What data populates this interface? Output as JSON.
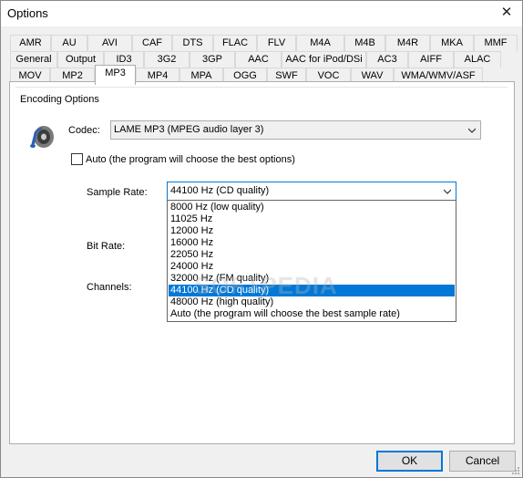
{
  "window": {
    "title": "Options"
  },
  "tabs": {
    "row1": [
      "AMR",
      "AU",
      "AVI",
      "CAF",
      "DTS",
      "FLAC",
      "FLV",
      "M4A",
      "M4B",
      "M4R",
      "MKA",
      "MMF"
    ],
    "row2": [
      "General",
      "Output",
      "ID3",
      "3G2",
      "3GP",
      "AAC",
      "AAC for iPod/DSi",
      "AC3",
      "AIFF",
      "ALAC"
    ],
    "row3": [
      "MOV",
      "MP2",
      "MP3",
      "MP4",
      "MPA",
      "OGG",
      "SWF",
      "VOC",
      "WAV",
      "WMA/WMV/ASF"
    ],
    "active": "MP3"
  },
  "encoding": {
    "group_label": "Encoding Options",
    "codec_label": "Codec:",
    "codec_value": "LAME MP3 (MPEG audio layer 3)",
    "auto_label": "Auto (the program will choose the best options)",
    "auto_checked": false,
    "sample_rate_label": "Sample Rate:",
    "sample_rate_value": "44100 Hz (CD quality)",
    "bit_rate_label": "Bit Rate:",
    "channels_label": "Channels:"
  },
  "sample_rate_options": [
    "8000 Hz (low quality)",
    "11025 Hz",
    "12000 Hz",
    "16000 Hz",
    "22050 Hz",
    "24000 Hz",
    "32000 Hz (FM quality)",
    "44100 Hz (CD quality)",
    "48000 Hz (high quality)",
    "Auto (the program will choose the best sample rate)"
  ],
  "selected_option_index": 7,
  "buttons": {
    "ok": "OK",
    "cancel": "Cancel"
  },
  "watermark": "SOFTPEDIA",
  "colors": {
    "accent": "#0078d7",
    "panel": "#ffffff",
    "chrome": "#f0f0f0"
  }
}
